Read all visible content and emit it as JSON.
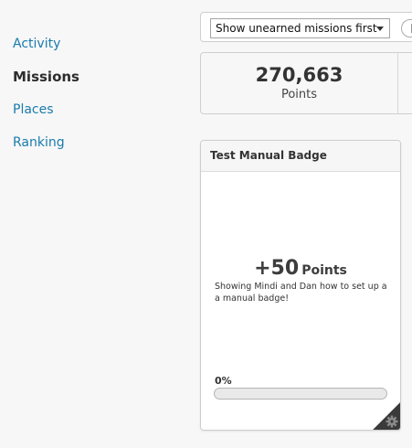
{
  "sidebar": {
    "items": [
      {
        "label": "Activity",
        "active": false
      },
      {
        "label": "Missions",
        "active": true
      },
      {
        "label": "Places",
        "active": false
      },
      {
        "label": "Ranking",
        "active": false
      }
    ]
  },
  "toolbar": {
    "sort_select_value": "Show unearned missions first"
  },
  "stats": {
    "points_value": "270,663",
    "points_label": "Points"
  },
  "badge_card": {
    "title": "Test Manual Badge",
    "reward_value": "+50",
    "reward_label": "Points",
    "description": "Showing Mindi and Dan how to set up a a manual badge!",
    "progress_text": "0%",
    "progress_fraction": 0,
    "corner_icon": "gear-icon"
  },
  "colors": {
    "link": "#1a7bab",
    "active_nav": "#2c2c2c",
    "corner_fold": "#3a3a3a"
  }
}
